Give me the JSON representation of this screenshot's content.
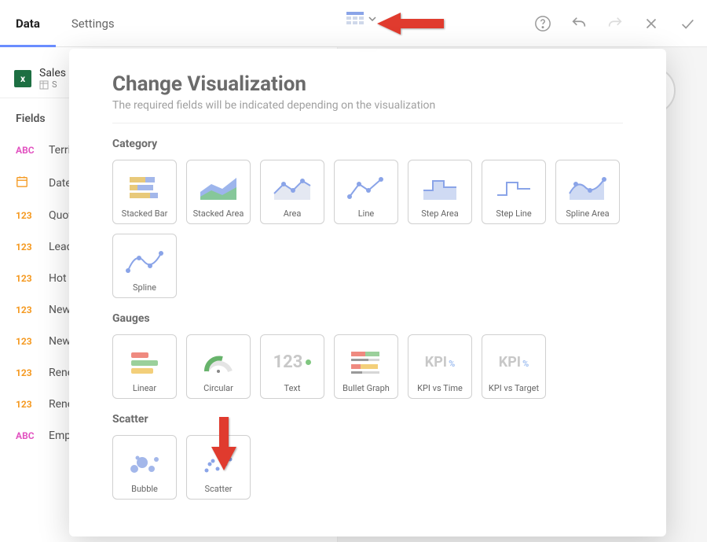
{
  "tabs": {
    "data": "Data",
    "settings": "Settings"
  },
  "datasource": {
    "name": "Sales",
    "sheet": "S"
  },
  "fields_header": "Fields",
  "fields": [
    {
      "type": "abc",
      "label": "Territory"
    },
    {
      "type": "date",
      "label": "Date"
    },
    {
      "type": "num",
      "label": "Quota"
    },
    {
      "type": "num",
      "label": "Leads"
    },
    {
      "type": "num",
      "label": "Hot Leads"
    },
    {
      "type": "num",
      "label": "New Sales"
    },
    {
      "type": "num",
      "label": "New Seats"
    },
    {
      "type": "num",
      "label": "Renewal Sales"
    },
    {
      "type": "num",
      "label": "Renewal Seats"
    },
    {
      "type": "abc",
      "label": "Employee"
    }
  ],
  "type_labels": {
    "abc": "ABC",
    "num": "123"
  },
  "popover": {
    "title": "Change Visualization",
    "subtitle": "The required fields will be indicated depending on the visualization",
    "sections": {
      "category": "Category",
      "gauges": "Gauges",
      "scatter": "Scatter"
    },
    "category_items": [
      "Stacked Bar",
      "Stacked Area",
      "Area",
      "Line",
      "Step Area",
      "Step Line",
      "Spline Area",
      "Spline"
    ],
    "gauges_items": [
      "Linear",
      "Circular",
      "Text",
      "Bullet Graph",
      "KPI vs Time",
      "KPI vs Target"
    ],
    "scatter_items": [
      "Bubble",
      "Scatter"
    ],
    "kpi_label": "KPI",
    "kpi_pct": "%",
    "text_gauge": "123"
  }
}
